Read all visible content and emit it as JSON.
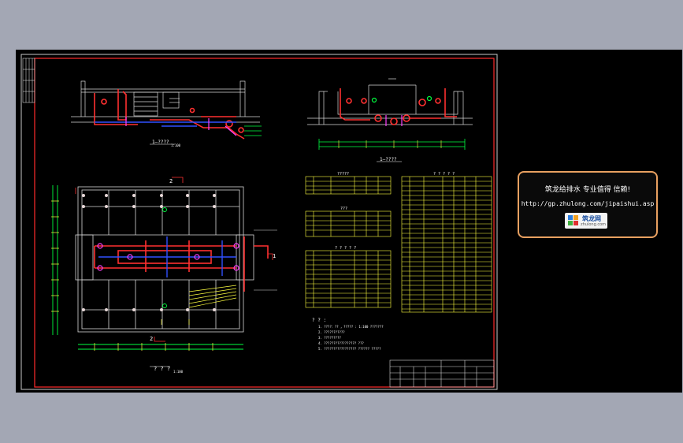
{
  "drawing": {
    "section_1_label": "1—????",
    "section_1_scale": "1:100",
    "section_2_label": "1—????",
    "plan_label": "? ? ?",
    "plan_scale": "1:100",
    "marker_2_top": "2",
    "marker_2_bottom": "2",
    "marker_1_right": "1",
    "table_1_title": "?????",
    "table_2_title": "???",
    "table_3_title": "? ? ? ? ?",
    "table_4_title": "? ? ? ? ?",
    "notes_title": "? ? :",
    "notes": [
      "1. ????：?? ，????? : 1:100 ???????",
      "2. ???????????",
      "3. ?????????",
      "4. ????????????????? ???",
      "5. ????????????????? ?????? ?????"
    ]
  },
  "ad": {
    "headline": "筑龙给排水 专业值得 信赖!",
    "url": "http://gp.zhulong.com/jipaishui.asp",
    "logo_text": "筑龙网",
    "logo_sub": "zhulong.com"
  },
  "colors": {
    "background": "#a3a7b4",
    "canvas": "#000000",
    "frame": "#ff2a2a",
    "ad_border": "#e8a060"
  }
}
